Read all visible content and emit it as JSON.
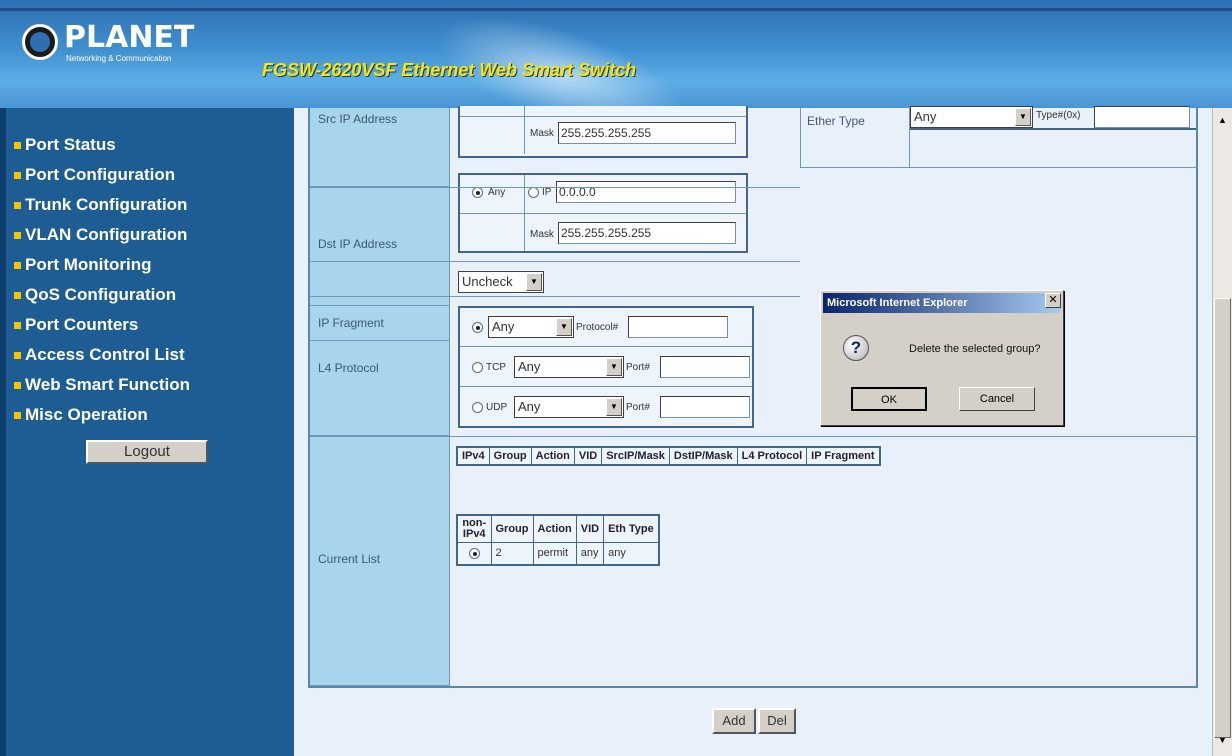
{
  "header": {
    "brand": "PLANET",
    "tagline": "Networking & Communication",
    "product_title": "FGSW-2620VSF Ethernet Web Smart Switch"
  },
  "sidebar": {
    "items": [
      {
        "label": "Port Status"
      },
      {
        "label": "Port Configuration"
      },
      {
        "label": "Trunk Configuration"
      },
      {
        "label": "VLAN Configuration"
      },
      {
        "label": "Port Monitoring"
      },
      {
        "label": "QoS Configuration"
      },
      {
        "label": "Port Counters"
      },
      {
        "label": "Access Control List"
      },
      {
        "label": "Web Smart Function"
      },
      {
        "label": "Misc Operation"
      }
    ],
    "logout_label": "Logout"
  },
  "form": {
    "src_ip": {
      "label": "Src IP Address",
      "mask_label": "Mask",
      "mask_value": "255.255.255.255"
    },
    "ether_type": {
      "label": "Ether Type",
      "select_value": "Any",
      "type_label": "Type#(0x)",
      "type_value": ""
    },
    "dst_ip": {
      "label": "Dst IP Address",
      "any_label": "Any",
      "ip_label": "IP",
      "ip_value": "0.0.0.0",
      "mask_label": "Mask",
      "mask_value": "255.255.255.255"
    },
    "ip_fragment": {
      "label": "IP Fragment",
      "select_value": "Uncheck"
    },
    "l4_protocol": {
      "label": "L4 Protocol",
      "any_select": "Any",
      "protocol_label": "Protocol#",
      "tcp_label": "TCP",
      "tcp_select": "Any",
      "tcp_port_label": "Port#",
      "udp_label": "UDP",
      "udp_select": "Any",
      "udp_port_label": "Port#"
    },
    "current_list": {
      "label": "Current List",
      "ipv4_headers": [
        "IPv4",
        "Group",
        "Action",
        "VID",
        "SrcIP/Mask",
        "DstIP/Mask",
        "L4 Protocol",
        "IP Fragment"
      ],
      "nonipv4_headers": [
        "non-IPv4",
        "Group",
        "Action",
        "VID",
        "Eth Type"
      ],
      "nonipv4_rows": [
        {
          "group": "2",
          "action": "permit",
          "vid": "any",
          "eth_type": "any"
        }
      ]
    }
  },
  "buttons": {
    "add": "Add",
    "del": "Del"
  },
  "dialog": {
    "title": "Microsoft Internet Explorer",
    "message": "Delete the selected group?",
    "ok": "OK",
    "cancel": "Cancel"
  }
}
